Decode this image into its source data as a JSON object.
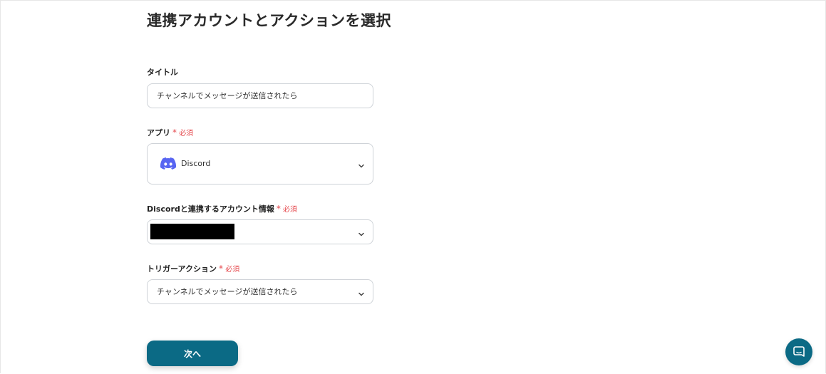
{
  "page": {
    "title": "連携アカウントとアクションを選択"
  },
  "form": {
    "title_field": {
      "label": "タイトル",
      "value": "チャンネルでメッセージが送信されたら"
    },
    "app_field": {
      "label": "アプリ",
      "required_mark": "*",
      "required_text": "必須",
      "value": "Discord",
      "icon": "discord-icon"
    },
    "account_field": {
      "label": "Discordと連携するアカウント情報",
      "required_mark": "*",
      "required_text": "必須",
      "value_redacted": true
    },
    "trigger_field": {
      "label": "トリガーアクション",
      "required_mark": "*",
      "required_text": "必須",
      "value": "チャンネルでメッセージが送信されたら"
    }
  },
  "actions": {
    "next_label": "次へ"
  },
  "widgets": {
    "chat_icon": "chat-bubble-icon"
  },
  "colors": {
    "primary": "#0b6a85",
    "required": "#e5484d",
    "discord": "#5865f2",
    "border": "#cfd3d8"
  }
}
